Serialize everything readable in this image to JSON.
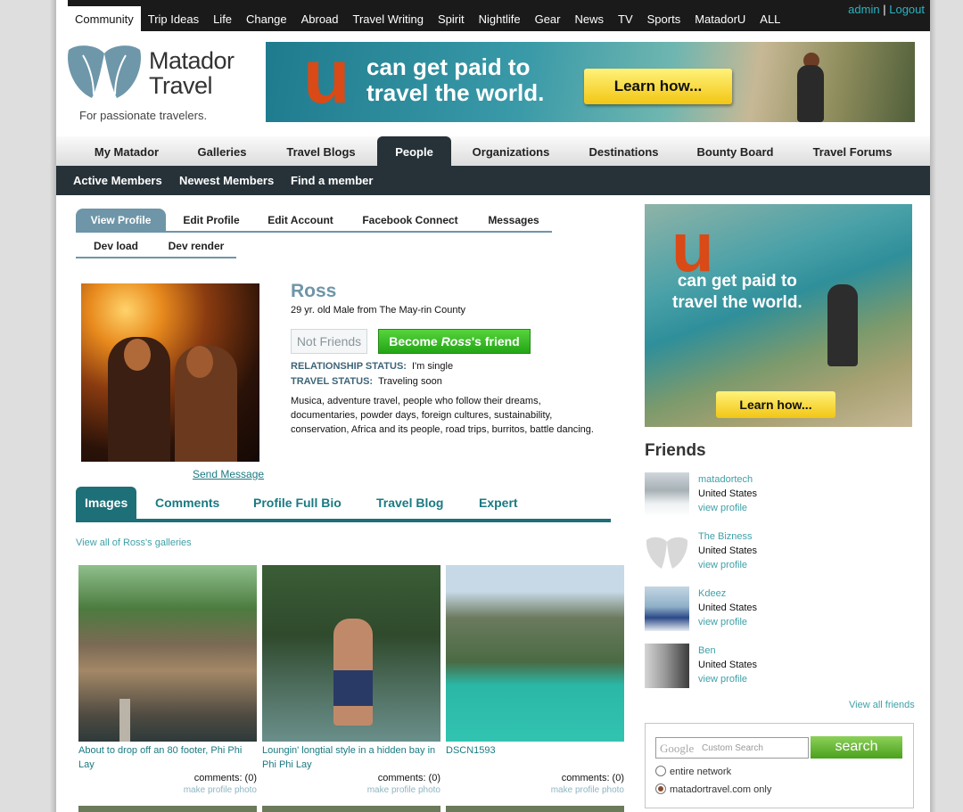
{
  "topnav": {
    "items": [
      "Community",
      "Trip Ideas",
      "Life",
      "Change",
      "Abroad",
      "Travel Writing",
      "Spirit",
      "Nightlife",
      "Gear",
      "News",
      "TV",
      "Sports",
      "MatadorU",
      "ALL"
    ],
    "user": "admin",
    "separator": "|",
    "logout": "Logout"
  },
  "logo": {
    "name_line1": "Matador",
    "name_line2": "Travel",
    "tagline": "For passionate travelers."
  },
  "banner": {
    "letter": "u",
    "line1": "can get paid to",
    "line2": "travel the world.",
    "button": "Learn how..."
  },
  "mainnav": {
    "items": [
      "My Matador",
      "Galleries",
      "Travel Blogs",
      "People",
      "Organizations",
      "Destinations",
      "Bounty Board",
      "Travel Forums"
    ],
    "active": "People"
  },
  "subnav": {
    "items": [
      "Active Members",
      "Newest Members",
      "Find a member"
    ]
  },
  "profile_tabs": {
    "row1": [
      "View Profile",
      "Edit Profile",
      "Edit Account",
      "Facebook Connect",
      "Messages"
    ],
    "row2": [
      "Dev load",
      "Dev render"
    ],
    "active": "View Profile"
  },
  "profile": {
    "name": "Ross",
    "info": "29 yr. old Male from The May-rin County",
    "not_friends": "Not Friends",
    "become_friend_pre": "Become ",
    "become_friend_name": "Ross",
    "become_friend_post": "'s friend",
    "relationship_label": "RELATIONSHIP STATUS:",
    "relationship_value": "I'm single",
    "travel_label": "TRAVEL STATUS:",
    "travel_value": "Traveling soon",
    "bio": "Musica, adventure travel, people who follow their dreams, documentaries, powder days, foreign cultures, sustainability, conservation, Africa and its people, road trips, burritos, battle dancing.",
    "send_message": "Send Message"
  },
  "content_tabs": {
    "items": [
      "Images",
      "Comments",
      "Profile Full Bio",
      "Travel Blog",
      "Expert"
    ],
    "active": "Images"
  },
  "images": {
    "view_all": "View all of Ross's galleries",
    "items": [
      {
        "caption": "About to drop off an 80 footer, Phi Phi Lay",
        "comments": "comments: (0)",
        "action": "make profile photo"
      },
      {
        "caption": "Loungin' longtial style in a hidden bay in Phi Phi Lay",
        "comments": "comments: (0)",
        "action": "make profile photo"
      },
      {
        "caption": "DSCN1593",
        "comments": "comments: (0)",
        "action": "make profile photo"
      }
    ]
  },
  "sidebar_ad": {
    "letter": "u",
    "line1": "can get paid to",
    "line2": "travel the world.",
    "button": "Learn how..."
  },
  "friends": {
    "title": "Friends",
    "items": [
      {
        "name": "matadortech",
        "country": "United States",
        "link": "view profile"
      },
      {
        "name": "The Bizness",
        "country": "United States",
        "link": "view profile"
      },
      {
        "name": "Kdeez",
        "country": "United States",
        "link": "view profile"
      },
      {
        "name": "Ben",
        "country": "United States",
        "link": "view profile"
      }
    ],
    "view_all": "View all friends"
  },
  "search": {
    "google_label": "Google",
    "placeholder": "Custom Search",
    "button": "search",
    "options": [
      "entire network",
      "matadortravel.com only"
    ],
    "selected": "matadortravel.com only"
  },
  "colors": {
    "accent_teal": "#1d6f78",
    "link_teal": "#3fa0a8",
    "nav_dark": "#263238",
    "profile_tab": "#6f95a8",
    "friend_green": "#23a516",
    "banner_orange": "#d94a16"
  }
}
